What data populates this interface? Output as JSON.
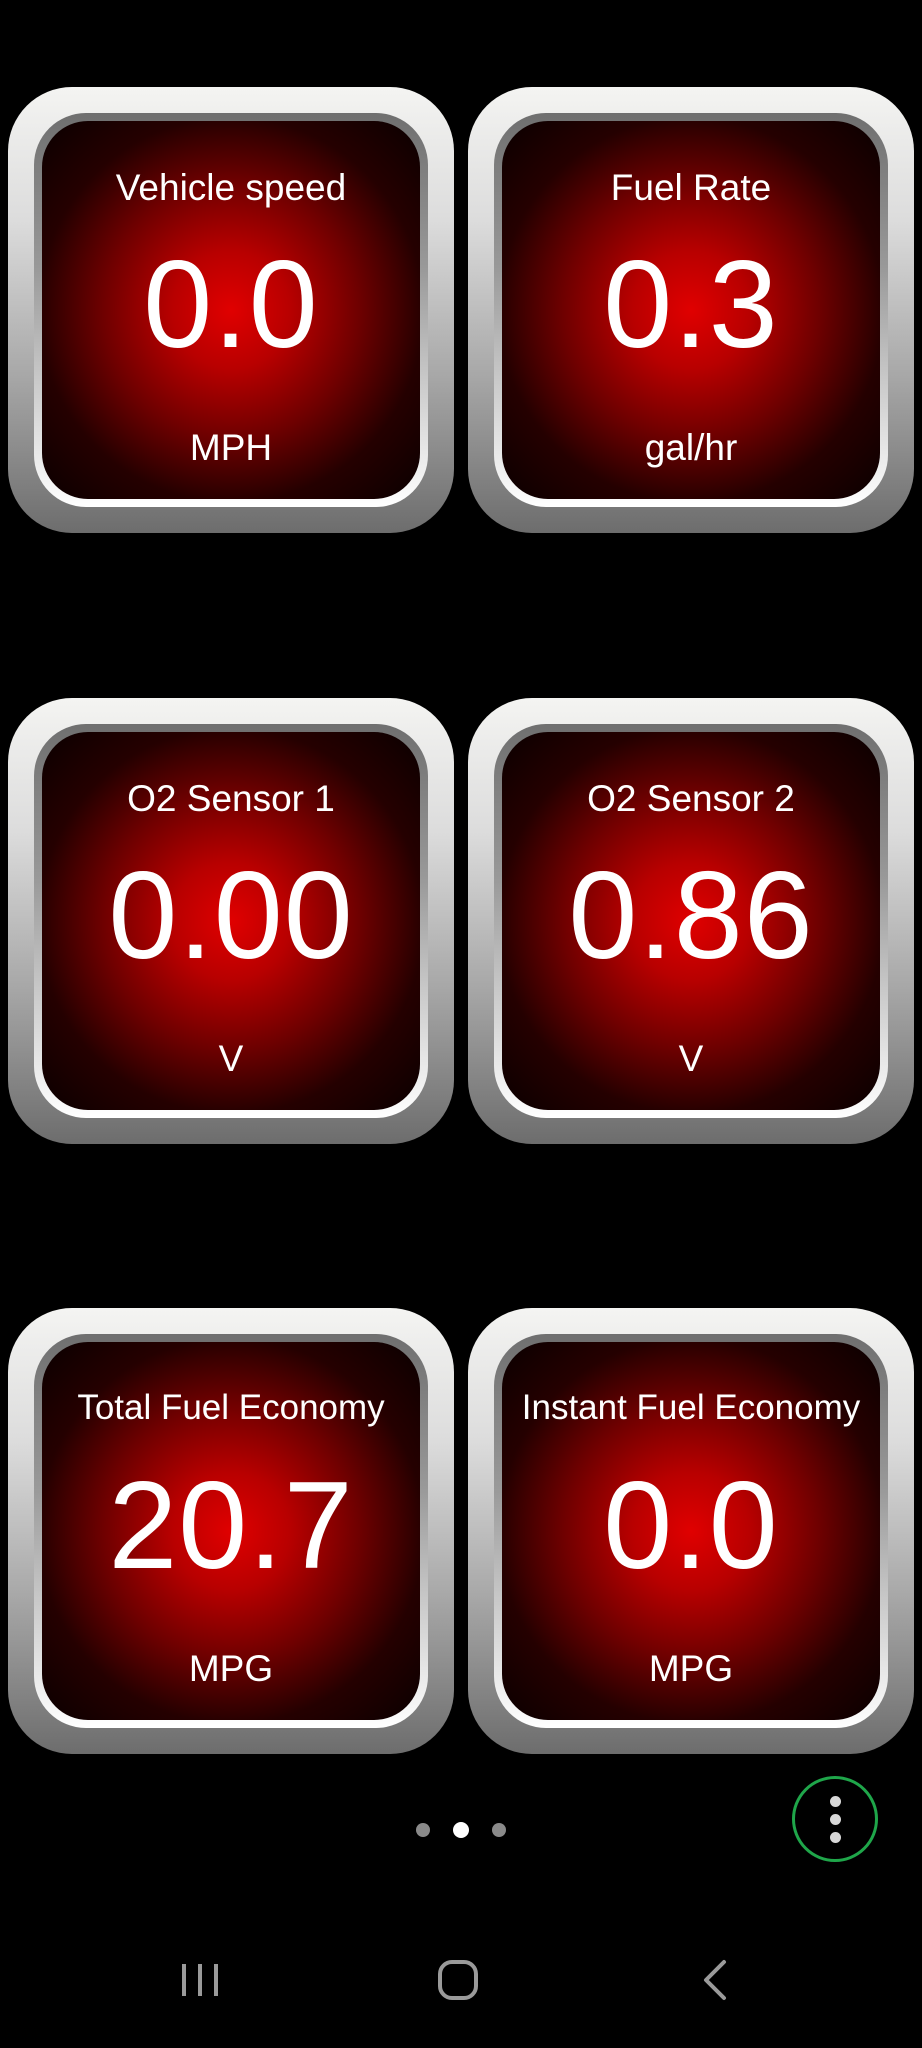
{
  "gauges": [
    {
      "label": "Vehicle speed",
      "value": "0.0",
      "unit": "MPH"
    },
    {
      "label": "Fuel Rate",
      "value": "0.3",
      "unit": "gal/hr"
    },
    {
      "label": "O2 Sensor 1",
      "value": "0.00",
      "unit": "V"
    },
    {
      "label": "O2 Sensor 2",
      "value": "0.86",
      "unit": "V"
    },
    {
      "label": "Total Fuel Economy",
      "value": "20.7",
      "unit": "MPG"
    },
    {
      "label": "Instant Fuel Economy",
      "value": "0.0",
      "unit": "MPG"
    }
  ],
  "pager": {
    "pages": 3,
    "active_index": 1
  },
  "colors": {
    "background": "#000000",
    "gauge_face": "#e00000",
    "menu_ring": "#1fa64a"
  },
  "icons": {
    "menu": "vertical-dots-icon",
    "recent": "recent-apps-icon",
    "home": "home-icon",
    "back": "back-icon"
  }
}
